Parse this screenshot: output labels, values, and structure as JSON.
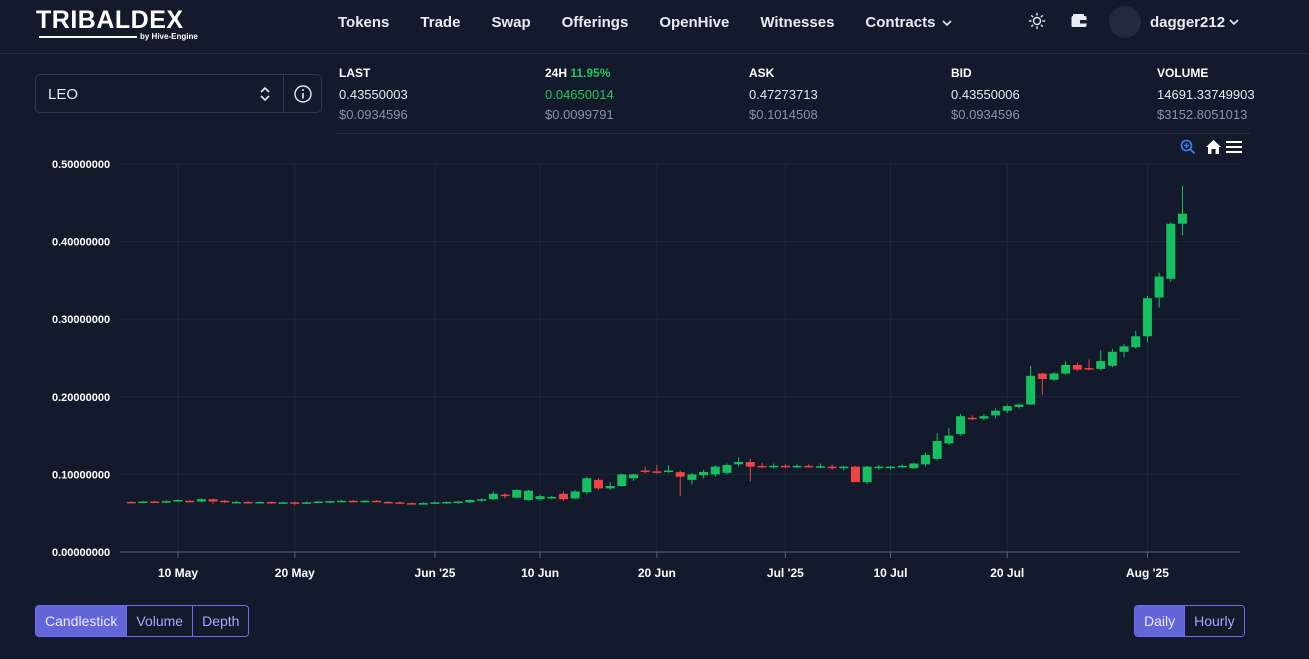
{
  "header": {
    "logo_text": "TRIBALDEX",
    "logo_sub": "by Hive-Engine",
    "nav": [
      {
        "label": "Tokens"
      },
      {
        "label": "Trade"
      },
      {
        "label": "Swap"
      },
      {
        "label": "Offerings"
      },
      {
        "label": "OpenHive"
      },
      {
        "label": "Witnesses"
      },
      {
        "label": "Contracts"
      }
    ],
    "theme_icon": "sun-icon",
    "wallet_icon": "wallet-icon",
    "username": "dagger212"
  },
  "token_selector": {
    "value": "LEO",
    "info_icon": "info-icon"
  },
  "stats": [
    {
      "label": "LAST",
      "value": "0.43550003",
      "usd": "$0.0934596"
    },
    {
      "label": "24H",
      "pct": "11.95%",
      "value": "0.04650014",
      "usd": "$0.0099791"
    },
    {
      "label": "ASK",
      "value": "0.47273713",
      "usd": "$0.1014508"
    },
    {
      "label": "BID",
      "value": "0.43550006",
      "usd": "$0.0934596"
    },
    {
      "label": "VOLUME",
      "value": "14691.33749903",
      "usd": "$3152.8051013"
    }
  ],
  "chart_tools": [
    "zoom-in-icon",
    "home-icon",
    "menu-icon"
  ],
  "chart_data": {
    "type": "candlestick",
    "ylim": [
      0,
      0.5
    ],
    "y_ticks": [
      "0.50000000",
      "0.40000000",
      "0.30000000",
      "0.20000000",
      "0.10000000",
      "0.00000000"
    ],
    "x_ticks": [
      {
        "label": "10 May",
        "date": "2025-05-10"
      },
      {
        "label": "20 May",
        "date": "2025-05-20"
      },
      {
        "label": "Jun '25",
        "date": "2025-06-01"
      },
      {
        "label": "10 Jun",
        "date": "2025-06-10"
      },
      {
        "label": "20 Jun",
        "date": "2025-06-20"
      },
      {
        "label": "Jul '25",
        "date": "2025-07-01"
      },
      {
        "label": "10 Jul",
        "date": "2025-07-10"
      },
      {
        "label": "20 Jul",
        "date": "2025-07-20"
      },
      {
        "label": "Aug '25",
        "date": "2025-08-01"
      }
    ],
    "colors": {
      "up": "#16c060",
      "down": "#ef4444",
      "grid": "#1e2638",
      "axis": "#5a6275"
    },
    "candles": [
      {
        "date": "2025-05-06",
        "open": 0.0645,
        "high": 0.0655,
        "low": 0.0635,
        "close": 0.064
      },
      {
        "date": "2025-05-07",
        "open": 0.064,
        "high": 0.066,
        "low": 0.063,
        "close": 0.065
      },
      {
        "date": "2025-05-08",
        "open": 0.065,
        "high": 0.066,
        "low": 0.063,
        "close": 0.064
      },
      {
        "date": "2025-05-09",
        "open": 0.064,
        "high": 0.0665,
        "low": 0.063,
        "close": 0.0655
      },
      {
        "date": "2025-05-10",
        "open": 0.0655,
        "high": 0.068,
        "low": 0.064,
        "close": 0.067
      },
      {
        "date": "2025-05-11",
        "open": 0.066,
        "high": 0.067,
        "low": 0.064,
        "close": 0.065
      },
      {
        "date": "2025-05-12",
        "open": 0.065,
        "high": 0.069,
        "low": 0.064,
        "close": 0.068
      },
      {
        "date": "2025-05-13",
        "open": 0.068,
        "high": 0.069,
        "low": 0.062,
        "close": 0.065
      },
      {
        "date": "2025-05-14",
        "open": 0.066,
        "high": 0.067,
        "low": 0.063,
        "close": 0.064
      },
      {
        "date": "2025-05-15",
        "open": 0.064,
        "high": 0.066,
        "low": 0.063,
        "close": 0.0645
      },
      {
        "date": "2025-05-16",
        "open": 0.0645,
        "high": 0.0655,
        "low": 0.063,
        "close": 0.064
      },
      {
        "date": "2025-05-17",
        "open": 0.064,
        "high": 0.065,
        "low": 0.063,
        "close": 0.0645
      },
      {
        "date": "2025-05-18",
        "open": 0.0645,
        "high": 0.065,
        "low": 0.062,
        "close": 0.063
      },
      {
        "date": "2025-05-19",
        "open": 0.063,
        "high": 0.065,
        "low": 0.062,
        "close": 0.064
      },
      {
        "date": "2025-05-20",
        "open": 0.064,
        "high": 0.065,
        "low": 0.06,
        "close": 0.063
      },
      {
        "date": "2025-05-21",
        "open": 0.063,
        "high": 0.065,
        "low": 0.062,
        "close": 0.064
      },
      {
        "date": "2025-05-22",
        "open": 0.064,
        "high": 0.066,
        "low": 0.063,
        "close": 0.065
      },
      {
        "date": "2025-05-23",
        "open": 0.065,
        "high": 0.066,
        "low": 0.063,
        "close": 0.0655
      },
      {
        "date": "2025-05-24",
        "open": 0.0655,
        "high": 0.067,
        "low": 0.064,
        "close": 0.066
      },
      {
        "date": "2025-05-25",
        "open": 0.066,
        "high": 0.067,
        "low": 0.064,
        "close": 0.065
      },
      {
        "date": "2025-05-26",
        "open": 0.065,
        "high": 0.067,
        "low": 0.064,
        "close": 0.066
      },
      {
        "date": "2025-05-27",
        "open": 0.066,
        "high": 0.067,
        "low": 0.064,
        "close": 0.0645
      },
      {
        "date": "2025-05-28",
        "open": 0.0645,
        "high": 0.0655,
        "low": 0.063,
        "close": 0.064
      },
      {
        "date": "2025-05-29",
        "open": 0.064,
        "high": 0.065,
        "low": 0.062,
        "close": 0.063
      },
      {
        "date": "2025-05-30",
        "open": 0.063,
        "high": 0.064,
        "low": 0.061,
        "close": 0.062
      },
      {
        "date": "2025-05-31",
        "open": 0.062,
        "high": 0.064,
        "low": 0.061,
        "close": 0.063
      },
      {
        "date": "2025-06-01",
        "open": 0.063,
        "high": 0.065,
        "low": 0.062,
        "close": 0.064
      },
      {
        "date": "2025-06-02",
        "open": 0.063,
        "high": 0.065,
        "low": 0.062,
        "close": 0.0645
      },
      {
        "date": "2025-06-03",
        "open": 0.0645,
        "high": 0.066,
        "low": 0.062,
        "close": 0.065
      },
      {
        "date": "2025-06-04",
        "open": 0.064,
        "high": 0.068,
        "low": 0.063,
        "close": 0.067
      },
      {
        "date": "2025-06-05",
        "open": 0.067,
        "high": 0.069,
        "low": 0.065,
        "close": 0.068
      },
      {
        "date": "2025-06-06",
        "open": 0.068,
        "high": 0.078,
        "low": 0.067,
        "close": 0.075
      },
      {
        "date": "2025-06-07",
        "open": 0.074,
        "high": 0.076,
        "low": 0.069,
        "close": 0.072
      },
      {
        "date": "2025-06-08",
        "open": 0.07,
        "high": 0.081,
        "low": 0.07,
        "close": 0.08
      },
      {
        "date": "2025-06-09",
        "open": 0.067,
        "high": 0.08,
        "low": 0.066,
        "close": 0.079
      },
      {
        "date": "2025-06-10",
        "open": 0.068,
        "high": 0.074,
        "low": 0.066,
        "close": 0.072
      },
      {
        "date": "2025-06-11",
        "open": 0.07,
        "high": 0.072,
        "low": 0.068,
        "close": 0.071
      },
      {
        "date": "2025-06-12",
        "open": 0.075,
        "high": 0.078,
        "low": 0.066,
        "close": 0.068
      },
      {
        "date": "2025-06-13",
        "open": 0.069,
        "high": 0.08,
        "low": 0.068,
        "close": 0.078
      },
      {
        "date": "2025-06-14",
        "open": 0.077,
        "high": 0.097,
        "low": 0.074,
        "close": 0.095
      },
      {
        "date": "2025-06-15",
        "open": 0.093,
        "high": 0.095,
        "low": 0.08,
        "close": 0.082
      },
      {
        "date": "2025-06-16",
        "open": 0.082,
        "high": 0.09,
        "low": 0.08,
        "close": 0.085
      },
      {
        "date": "2025-06-17",
        "open": 0.085,
        "high": 0.101,
        "low": 0.084,
        "close": 0.1
      },
      {
        "date": "2025-06-18",
        "open": 0.095,
        "high": 0.101,
        "low": 0.092,
        "close": 0.1
      },
      {
        "date": "2025-06-19",
        "open": 0.105,
        "high": 0.11,
        "low": 0.101,
        "close": 0.104
      },
      {
        "date": "2025-06-20",
        "open": 0.104,
        "high": 0.112,
        "low": 0.101,
        "close": 0.103
      },
      {
        "date": "2025-06-21",
        "open": 0.104,
        "high": 0.112,
        "low": 0.102,
        "close": 0.105
      },
      {
        "date": "2025-06-22",
        "open": 0.103,
        "high": 0.105,
        "low": 0.072,
        "close": 0.097
      },
      {
        "date": "2025-06-23",
        "open": 0.093,
        "high": 0.102,
        "low": 0.087,
        "close": 0.1
      },
      {
        "date": "2025-06-24",
        "open": 0.099,
        "high": 0.106,
        "low": 0.095,
        "close": 0.103
      },
      {
        "date": "2025-06-25",
        "open": 0.1,
        "high": 0.112,
        "low": 0.097,
        "close": 0.11
      },
      {
        "date": "2025-06-26",
        "open": 0.102,
        "high": 0.114,
        "low": 0.1,
        "close": 0.112
      },
      {
        "date": "2025-06-27",
        "open": 0.113,
        "high": 0.122,
        "low": 0.11,
        "close": 0.116
      },
      {
        "date": "2025-06-28",
        "open": 0.116,
        "high": 0.12,
        "low": 0.091,
        "close": 0.11
      },
      {
        "date": "2025-06-29",
        "open": 0.111,
        "high": 0.115,
        "low": 0.108,
        "close": 0.11
      },
      {
        "date": "2025-06-30",
        "open": 0.11,
        "high": 0.114,
        "low": 0.108,
        "close": 0.111
      },
      {
        "date": "2025-07-01",
        "open": 0.111,
        "high": 0.113,
        "low": 0.108,
        "close": 0.11
      },
      {
        "date": "2025-07-02",
        "open": 0.11,
        "high": 0.113,
        "low": 0.108,
        "close": 0.111
      },
      {
        "date": "2025-07-03",
        "open": 0.111,
        "high": 0.113,
        "low": 0.109,
        "close": 0.11
      },
      {
        "date": "2025-07-04",
        "open": 0.11,
        "high": 0.114,
        "low": 0.108,
        "close": 0.1105
      },
      {
        "date": "2025-07-05",
        "open": 0.11,
        "high": 0.113,
        "low": 0.106,
        "close": 0.108
      },
      {
        "date": "2025-07-06",
        "open": 0.108,
        "high": 0.111,
        "low": 0.105,
        "close": 0.11
      },
      {
        "date": "2025-07-07",
        "open": 0.11,
        "high": 0.111,
        "low": 0.09,
        "close": 0.09
      },
      {
        "date": "2025-07-08",
        "open": 0.09,
        "high": 0.111,
        "low": 0.088,
        "close": 0.11
      },
      {
        "date": "2025-07-09",
        "open": 0.109,
        "high": 0.112,
        "low": 0.106,
        "close": 0.11
      },
      {
        "date": "2025-07-10",
        "open": 0.109,
        "high": 0.111,
        "low": 0.106,
        "close": 0.11
      },
      {
        "date": "2025-07-11",
        "open": 0.11,
        "high": 0.113,
        "low": 0.108,
        "close": 0.111
      },
      {
        "date": "2025-07-12",
        "open": 0.108,
        "high": 0.115,
        "low": 0.107,
        "close": 0.114
      },
      {
        "date": "2025-07-13",
        "open": 0.113,
        "high": 0.128,
        "low": 0.11,
        "close": 0.125
      },
      {
        "date": "2025-07-14",
        "open": 0.12,
        "high": 0.153,
        "low": 0.118,
        "close": 0.143
      },
      {
        "date": "2025-07-15",
        "open": 0.14,
        "high": 0.16,
        "low": 0.138,
        "close": 0.15
      },
      {
        "date": "2025-07-16",
        "open": 0.152,
        "high": 0.178,
        "low": 0.15,
        "close": 0.175
      },
      {
        "date": "2025-07-17",
        "open": 0.173,
        "high": 0.176,
        "low": 0.17,
        "close": 0.172
      },
      {
        "date": "2025-07-18",
        "open": 0.172,
        "high": 0.178,
        "low": 0.17,
        "close": 0.175
      },
      {
        "date": "2025-07-19",
        "open": 0.176,
        "high": 0.185,
        "low": 0.172,
        "close": 0.182
      },
      {
        "date": "2025-07-20",
        "open": 0.182,
        "high": 0.19,
        "low": 0.179,
        "close": 0.188
      },
      {
        "date": "2025-07-21",
        "open": 0.187,
        "high": 0.191,
        "low": 0.185,
        "close": 0.19
      },
      {
        "date": "2025-07-22",
        "open": 0.19,
        "high": 0.24,
        "low": 0.19,
        "close": 0.227
      },
      {
        "date": "2025-07-23",
        "open": 0.23,
        "high": 0.231,
        "low": 0.202,
        "close": 0.223
      },
      {
        "date": "2025-07-24",
        "open": 0.222,
        "high": 0.232,
        "low": 0.22,
        "close": 0.23
      },
      {
        "date": "2025-07-25",
        "open": 0.23,
        "high": 0.246,
        "low": 0.228,
        "close": 0.241
      },
      {
        "date": "2025-07-26",
        "open": 0.241,
        "high": 0.244,
        "low": 0.233,
        "close": 0.235
      },
      {
        "date": "2025-07-27",
        "open": 0.237,
        "high": 0.248,
        "low": 0.234,
        "close": 0.236
      },
      {
        "date": "2025-07-28",
        "open": 0.236,
        "high": 0.26,
        "low": 0.234,
        "close": 0.246
      },
      {
        "date": "2025-07-29",
        "open": 0.24,
        "high": 0.262,
        "low": 0.238,
        "close": 0.258
      },
      {
        "date": "2025-07-30",
        "open": 0.258,
        "high": 0.268,
        "low": 0.251,
        "close": 0.265
      },
      {
        "date": "2025-07-31",
        "open": 0.264,
        "high": 0.285,
        "low": 0.262,
        "close": 0.278
      },
      {
        "date": "2025-08-01",
        "open": 0.278,
        "high": 0.33,
        "low": 0.27,
        "close": 0.327
      },
      {
        "date": "2025-08-02",
        "open": 0.328,
        "high": 0.36,
        "low": 0.315,
        "close": 0.355
      },
      {
        "date": "2025-08-03",
        "open": 0.352,
        "high": 0.425,
        "low": 0.348,
        "close": 0.423
      },
      {
        "date": "2025-08-04",
        "open": 0.423,
        "high": 0.472,
        "low": 0.408,
        "close": 0.436
      }
    ]
  },
  "chart_tabs": [
    {
      "label": "Candlestick",
      "active": true
    },
    {
      "label": "Volume",
      "active": false
    },
    {
      "label": "Depth",
      "active": false
    }
  ],
  "interval_tabs": [
    {
      "label": "Daily",
      "active": true
    },
    {
      "label": "Hourly",
      "active": false
    }
  ]
}
